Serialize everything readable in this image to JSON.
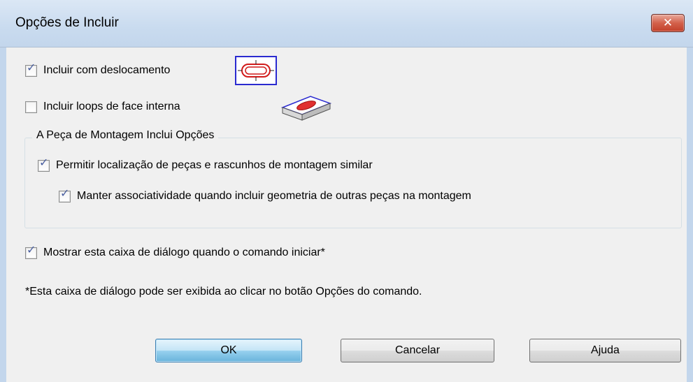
{
  "window": {
    "title": "Opções de Incluir",
    "close_glyph": "✕"
  },
  "options": {
    "include_offset": {
      "label": "Incluir com deslocamento",
      "checked": true
    },
    "include_inner_loops": {
      "label": "Incluir loops de face interna",
      "checked": false
    }
  },
  "assembly_group": {
    "title": "A Peça de Montagem Inclui Opções",
    "allow_locate": {
      "label": "Permitir localização de peças e rascunhos de montagem similar",
      "checked": true
    },
    "keep_associativity": {
      "label": "Manter associatividade quando incluir geometria de outras peças na montagem",
      "checked": true
    }
  },
  "show_dialog": {
    "label": "Mostrar esta caixa de diálogo quando o comando iniciar*",
    "checked": true
  },
  "note": "*Esta caixa de diálogo pode ser exibida ao clicar no botão Opções do comando.",
  "buttons": {
    "ok": "OK",
    "cancel": "Cancelar",
    "help": "Ajuda"
  },
  "icons": {
    "offset_preview": "offset-loop-icon",
    "inner_loop_preview": "face-inner-loop-icon"
  },
  "check_glyph": "✓",
  "colors": {
    "check": "#4a5fa0",
    "icon_border": "#2a2ad0",
    "icon_loop": "#d11a1a"
  }
}
